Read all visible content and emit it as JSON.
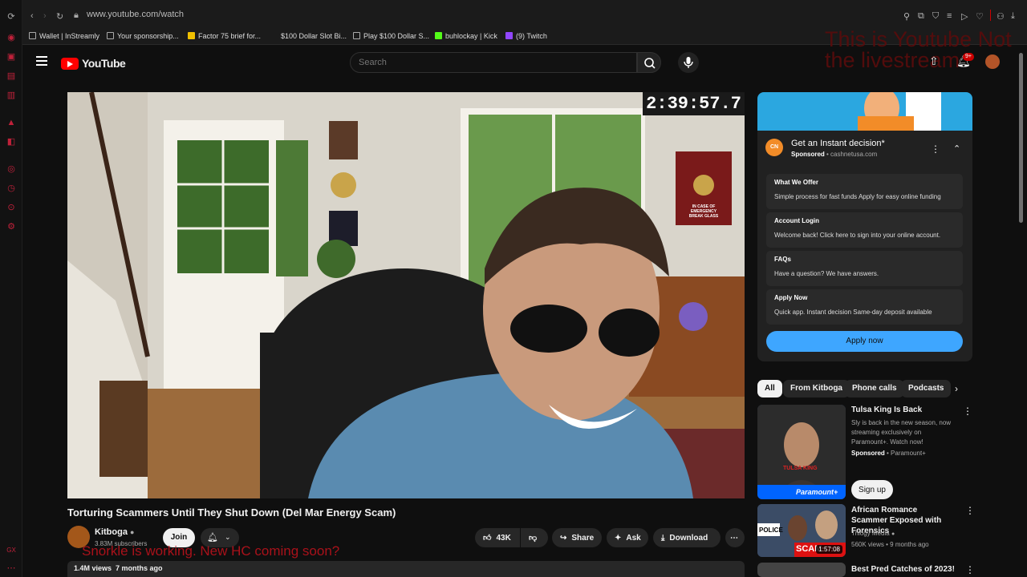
{
  "browser": {
    "url": "www.youtube.com/watch",
    "bookmarks": [
      "Wallet | InStreamly",
      "Your sponsorship...",
      "Factor 75 brief for...",
      "$100 Dollar Slot Bi...",
      "Play $100 Dollar S...",
      "buhlockay | Kick",
      "(9) Twitch"
    ]
  },
  "header": {
    "logo_text": "YouTube",
    "search_placeholder": "Search",
    "notifications_badge": "9+",
    "overlay_text": "This is Youtube Not the livestream"
  },
  "video": {
    "timer": "2:39:57.7",
    "title": "Torturing Scammers Until They Shut Down (Del Mar Energy Scam)",
    "channel": "Kitboga",
    "subscribers": "3.83M subscribers",
    "join_label": "Join",
    "likes": "43K",
    "share_label": "Share",
    "ask_label": "Ask",
    "download_label": "Download",
    "views": "1.4M views",
    "age": "7 months ago",
    "overlay_red": "Snorkle is working. New HC coming soon?",
    "scene_sign": "IN CASE OF EMERGENCY BREAK GLASS"
  },
  "ad": {
    "title": "Get an Instant decision*",
    "sponsored": "Sponsored",
    "domain": "cashnetusa.com",
    "logo_text": "CN",
    "rows": [
      {
        "title": "What We Offer",
        "desc": "Simple process for fast funds Apply for easy online funding"
      },
      {
        "title": "Account Login",
        "desc": "Welcome back! Click here to sign into your online account."
      },
      {
        "title": "FAQs",
        "desc": "Have a question? We have answers."
      },
      {
        "title": "Apply Now",
        "desc": "Quick app. Instant decision Same-day deposit available"
      }
    ],
    "cta": "Apply now"
  },
  "chips": [
    "All",
    "From Kitboga",
    "Phone calls",
    "Podcasts"
  ],
  "related": [
    {
      "title": "Tulsa King Is Back",
      "desc": "Sly is back in the new season, now streaming exclusively on Paramount+. Watch now!",
      "meta": "Sponsored",
      "channel": "Paramount+",
      "cta": "Sign up",
      "thumb_text": "TULSA KING",
      "brand": "Paramount+"
    },
    {
      "title": "African Romance Scammer Exposed with Forensics",
      "channel": "Trilogy Media",
      "meta": "560K views • 9 months ago",
      "duration": "1:57:08",
      "thumb_text": "SCAM",
      "thumb_label": "POLICE"
    },
    {
      "title": "Best Pred Catches of 2023!"
    }
  ],
  "colors": {
    "brand_red": "#ff0000",
    "accent_blue": "#3ea6ff",
    "overlay_red": "#c4121c"
  }
}
